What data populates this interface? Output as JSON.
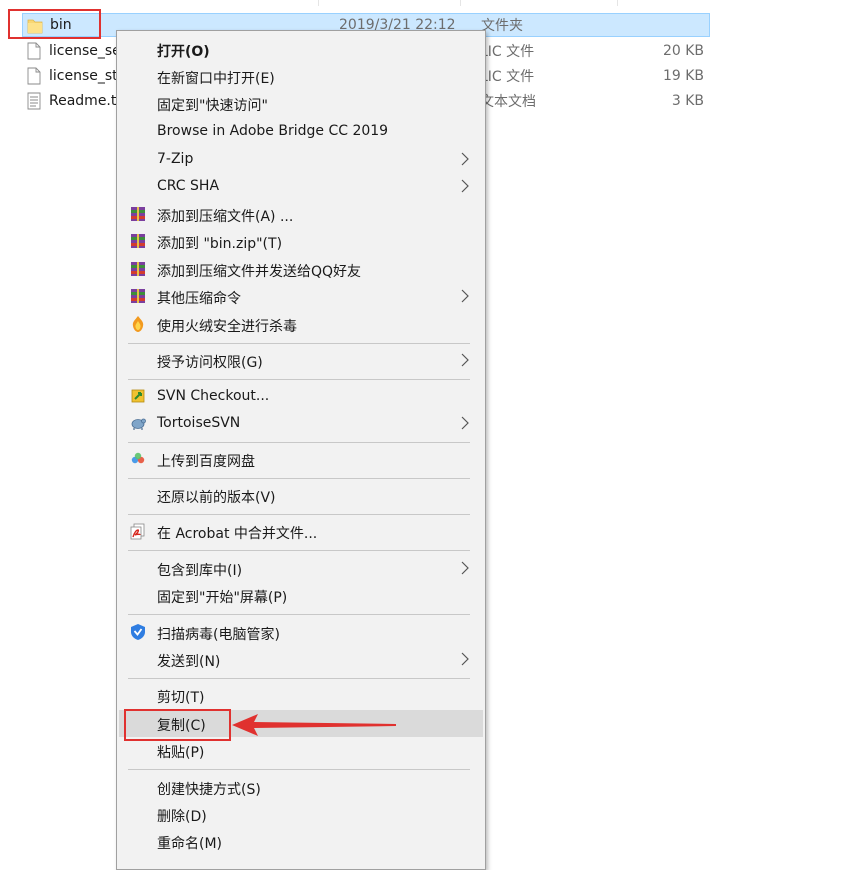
{
  "files": [
    {
      "name": "bin",
      "date": "2019/3/21 22:12",
      "type": "文件夹",
      "size": ""
    },
    {
      "name": "license_se",
      "date": "",
      "type": "LIC 文件",
      "size": "20 KB"
    },
    {
      "name": "license_st",
      "date": "",
      "type": "LIC 文件",
      "size": "19 KB"
    },
    {
      "name": "Readme.t",
      "date": "",
      "type": "文本文档",
      "size": "3 KB"
    }
  ],
  "menu": {
    "items": [
      {
        "label": "打开(O)"
      },
      {
        "label": "在新窗口中打开(E)"
      },
      {
        "label": "固定到\"快速访问\""
      },
      {
        "label": "Browse in Adobe Bridge CC 2019"
      },
      {
        "label": "7-Zip"
      },
      {
        "label": "CRC SHA"
      },
      {
        "label": "添加到压缩文件(A) ..."
      },
      {
        "label": "添加到 \"bin.zip\"(T)"
      },
      {
        "label": "添加到压缩文件并发送给QQ好友"
      },
      {
        "label": "其他压缩命令"
      },
      {
        "label": "使用火绒安全进行杀毒"
      },
      {
        "label": "授予访问权限(G)"
      },
      {
        "label": "SVN Checkout..."
      },
      {
        "label": "TortoiseSVN"
      },
      {
        "label": "上传到百度网盘"
      },
      {
        "label": "还原以前的版本(V)"
      },
      {
        "label": "在 Acrobat 中合并文件..."
      },
      {
        "label": "包含到库中(I)"
      },
      {
        "label": "固定到\"开始\"屏幕(P)"
      },
      {
        "label": "扫描病毒(电脑管家)"
      },
      {
        "label": "发送到(N)"
      },
      {
        "label": "剪切(T)"
      },
      {
        "label": "复制(C)"
      },
      {
        "label": "粘贴(P)"
      },
      {
        "label": "创建快捷方式(S)"
      },
      {
        "label": "删除(D)"
      },
      {
        "label": "重命名(M)"
      }
    ]
  },
  "colors": {
    "annotation_red": "#e0312f",
    "selection_blue": "#cce8ff",
    "menu_bg": "#f2f2f2"
  }
}
